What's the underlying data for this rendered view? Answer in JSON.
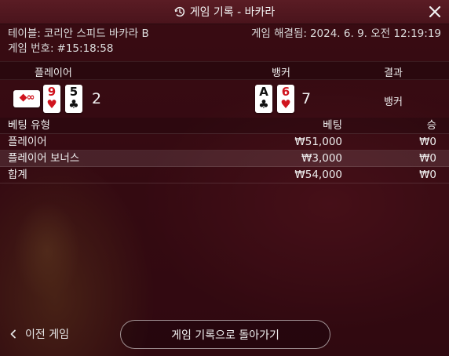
{
  "window": {
    "title": "게임 기록 - 바카라"
  },
  "info": {
    "table_label": "테이블:",
    "table_value": "코리안 스피드 바카라 B",
    "settled_label": "게임 해결됨:",
    "settled_value": "2024. 6. 9. 오전 12:19:19",
    "game_no_label": "게임 번호:",
    "game_no_value": "#15:18:58"
  },
  "results": {
    "player_header": "플레이어",
    "banker_header": "뱅커",
    "result_header": "결과",
    "player_cards": [
      {
        "rank": "9",
        "suit": "♥",
        "color": "red"
      },
      {
        "rank": "5",
        "suit": "♣",
        "color": "black"
      }
    ],
    "player_bonus_badge": "◆∞",
    "player_score": "2",
    "banker_cards": [
      {
        "rank": "A",
        "suit": "♣",
        "color": "black"
      },
      {
        "rank": "6",
        "suit": "♥",
        "color": "red"
      }
    ],
    "banker_score": "7",
    "result_value": "뱅커"
  },
  "bets": {
    "headers": {
      "type": "베팅 유형",
      "bet": "베팅",
      "win": "승"
    },
    "rows": [
      {
        "type": "플레이어",
        "bet": "₩51,000",
        "win": "₩0"
      },
      {
        "type": "플레이어 보너스",
        "bet": "₩3,000",
        "win": "₩0"
      }
    ],
    "total": {
      "type": "합계",
      "bet": "₩54,000",
      "win": "₩0"
    }
  },
  "footer": {
    "prev_game_label": "이전 게임",
    "back_to_history_label": "게임 기록으로 돌아가기"
  },
  "icons": {
    "history": "history-icon",
    "close": "close-icon",
    "prev": "chevron-left-icon"
  },
  "colors": {
    "card_red": "#d0141e",
    "background": "#4e1119"
  }
}
